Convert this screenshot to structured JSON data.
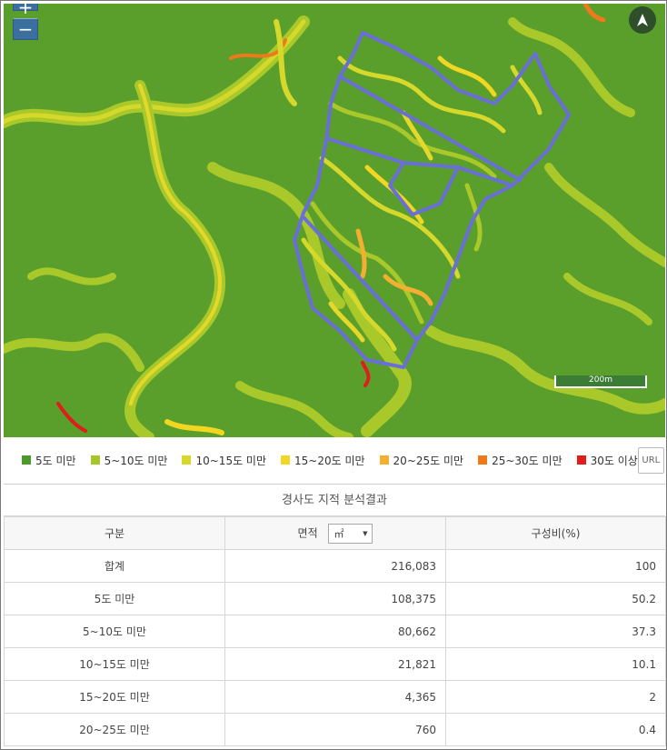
{
  "map": {
    "zoom_in_label": "+",
    "zoom_out_label": "−",
    "scale_label": "200m",
    "compass_icon": "north-arrow-icon",
    "colors": {
      "base_green": "#5a9e2c",
      "boundary": "#6a6fd8"
    }
  },
  "legend": {
    "items": [
      {
        "label": "5도 미만",
        "color": "#4c9a2a"
      },
      {
        "label": "5~10도 미만",
        "color": "#a6c52a"
      },
      {
        "label": "10~15도 미만",
        "color": "#d6d92b"
      },
      {
        "label": "15~20도 미만",
        "color": "#f2d722"
      },
      {
        "label": "20~25도 미만",
        "color": "#f3b030"
      },
      {
        "label": "25~30도 미만",
        "color": "#ee7a1c"
      },
      {
        "label": "30도 이상",
        "color": "#e21b1b"
      }
    ],
    "url_button": "URL",
    "shrink_icon": "collapse-arrows-icon"
  },
  "result": {
    "title": "경사도 지적 분석결과",
    "headers": {
      "category": "구분",
      "area": "면적",
      "ratio": "구성비(%)"
    },
    "unit_select": {
      "value": "㎡"
    },
    "rows": [
      {
        "category": "합계",
        "area": "216,083",
        "ratio": "100"
      },
      {
        "category": "5도 미만",
        "area": "108,375",
        "ratio": "50.2"
      },
      {
        "category": "5~10도 미만",
        "area": "80,662",
        "ratio": "37.3"
      },
      {
        "category": "10~15도 미만",
        "area": "21,821",
        "ratio": "10.1"
      },
      {
        "category": "15~20도 미만",
        "area": "4,365",
        "ratio": "2"
      },
      {
        "category": "20~25도 미만",
        "area": "760",
        "ratio": "0.4"
      }
    ]
  }
}
